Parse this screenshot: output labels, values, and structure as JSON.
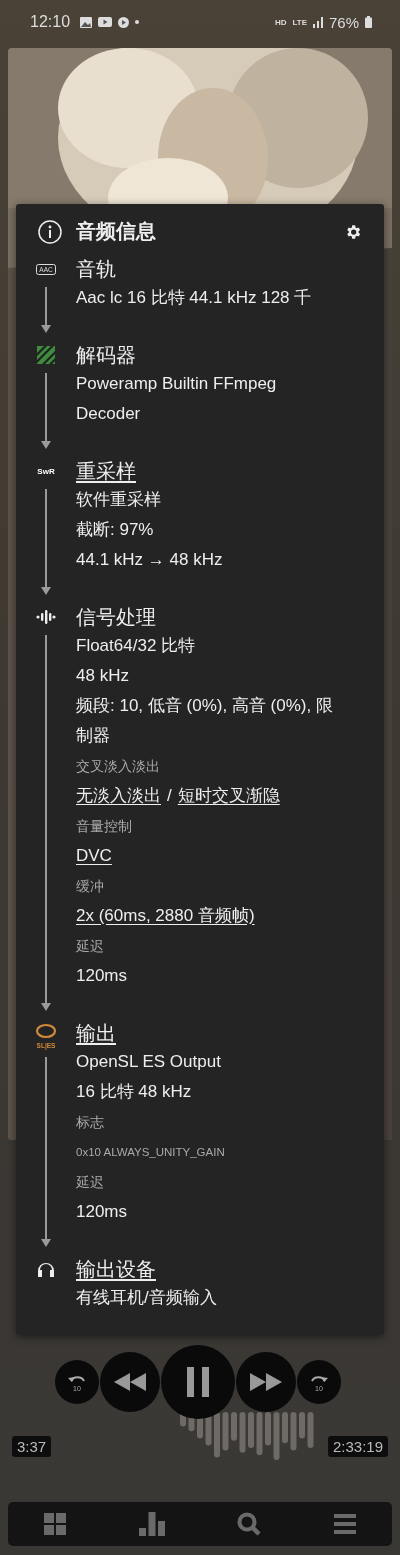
{
  "status_bar": {
    "time": "12:10",
    "network_badges": [
      "HD",
      "LTE"
    ],
    "battery": "76%"
  },
  "dialog": {
    "title": "音频信息",
    "sections": [
      {
        "kind": "aac",
        "icon_text": "AAC",
        "title": "音轨",
        "underlined": false,
        "lines": [
          {
            "kind": "value",
            "text": "Aac lc 16 比特 44.1 kHz 128 千"
          }
        ]
      },
      {
        "kind": "ffmpeg",
        "title": "解码器",
        "underlined": false,
        "lines": [
          {
            "kind": "value",
            "text": "Poweramp Builtin FFmpeg Decoder"
          }
        ]
      },
      {
        "kind": "swr",
        "icon_text": "SwR",
        "title": "重采样",
        "underlined": true,
        "lines": [
          {
            "kind": "value",
            "text": "软件重采样"
          },
          {
            "kind": "value",
            "text": "截断: 97%"
          },
          {
            "kind": "value",
            "text": "44.1 kHz → 48 kHz"
          }
        ]
      },
      {
        "kind": "dsp",
        "title": "信号处理",
        "underlined": false,
        "lines": [
          {
            "kind": "value",
            "text": "Float64/32 比特"
          },
          {
            "kind": "value",
            "text": "48 kHz"
          },
          {
            "kind": "value",
            "text": "频段: 10, 低音 (0%), 高音 (0%), 限制器"
          },
          {
            "kind": "label",
            "text": "交叉淡入淡出"
          },
          {
            "kind": "links",
            "parts": [
              "无淡入淡出",
              "短时交叉渐隐"
            ],
            "separator": "/"
          },
          {
            "kind": "label",
            "text": "音量控制"
          },
          {
            "kind": "link",
            "text": "DVC"
          },
          {
            "kind": "label",
            "text": "缓冲"
          },
          {
            "kind": "link",
            "text": "2x (60ms, 2880 音频帧)"
          },
          {
            "kind": "label",
            "text": "延迟"
          },
          {
            "kind": "value",
            "text": "120ms"
          }
        ]
      },
      {
        "kind": "opensl",
        "icon_text": "SL|ES",
        "title": "输出",
        "underlined": true,
        "lines": [
          {
            "kind": "value",
            "text": "OpenSL ES Output"
          },
          {
            "kind": "value",
            "text": "16 比特 48 kHz"
          },
          {
            "kind": "label",
            "text": "标志"
          },
          {
            "kind": "small",
            "text": "0x10 ALWAYS_UNITY_GAIN"
          },
          {
            "kind": "label",
            "text": "延迟"
          },
          {
            "kind": "value",
            "text": "120ms"
          }
        ]
      },
      {
        "kind": "headphones",
        "title": "输出设备",
        "underlined": true,
        "lines": [
          {
            "kind": "value",
            "text": "有线耳机/音频输入"
          }
        ]
      }
    ]
  },
  "player": {
    "skip_back": "10",
    "skip_forward": "10",
    "playing": true,
    "elapsed": "3:37",
    "remaining": "2:33:19"
  },
  "nav": [
    {
      "kind": "grid"
    },
    {
      "kind": "chart"
    },
    {
      "kind": "search"
    },
    {
      "kind": "menu"
    }
  ]
}
